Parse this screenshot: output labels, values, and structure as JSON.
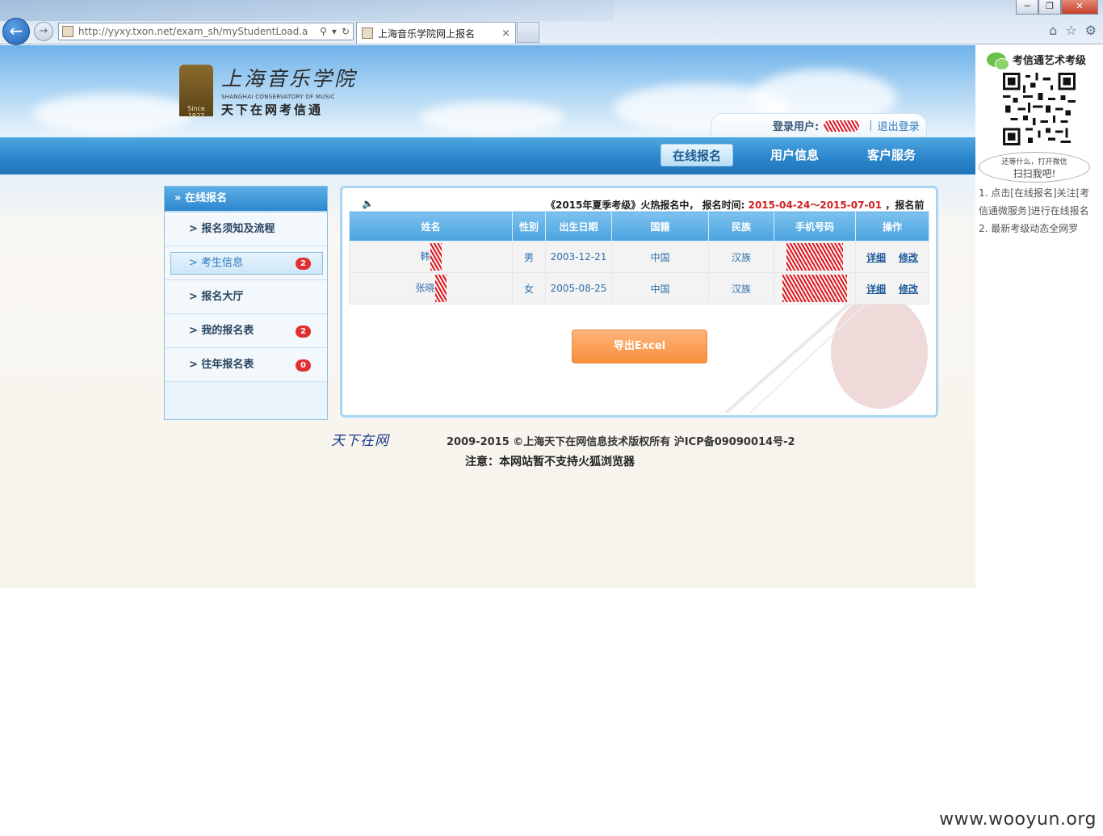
{
  "browser": {
    "url": "http://yyxy.txon.net/exam_sh/myStudentLoad.actic",
    "tab_title": "上海音乐学院网上报名",
    "tab_close": "×",
    "win_minimize": "─",
    "win_maximize": "❐",
    "win_close": "✕"
  },
  "header": {
    "school_cn": "上海音乐学院",
    "school_en": "SHANGHAI CONSERVATORY OF MUSIC",
    "since": "Since 1927",
    "slogan": "天下在网考信通",
    "login_label": "登录用户:",
    "username": "",
    "logout": "退出登录"
  },
  "nav": {
    "items": [
      {
        "label": "在线报名",
        "active": true
      },
      {
        "label": "用户信息",
        "active": false
      },
      {
        "label": "客户服务",
        "active": false
      }
    ]
  },
  "sidebar": {
    "title": "在线报名",
    "items": [
      {
        "label": "> 报名须知及流程",
        "badge": ""
      },
      {
        "label": "> 考生信息",
        "badge": "2"
      },
      {
        "label": "> 报名大厅",
        "badge": ""
      },
      {
        "label": "> 我的报名表",
        "badge": "2"
      },
      {
        "label": "> 往年报名表",
        "badge": "0"
      }
    ]
  },
  "announcement": {
    "prefix": "《2015年夏季考级》火热报名中，",
    "time_label": "报名时间:",
    "dates": "2015-04-24～2015-07-01",
    "suffix": "，报名前"
  },
  "table": {
    "headers": [
      "姓名",
      "性别",
      "出生日期",
      "国籍",
      "民族",
      "手机号码",
      "操作"
    ],
    "rows": [
      {
        "name": "韩",
        "gender": "男",
        "birth": "2003-12-21",
        "nationality": "中国",
        "ethnicity": "汉族",
        "phone": "",
        "detail": "详细",
        "edit": "修改"
      },
      {
        "name": "张晓",
        "gender": "女",
        "birth": "2005-08-25",
        "nationality": "中国",
        "ethnicity": "汉族",
        "phone": "",
        "detail": "详细",
        "edit": "修改"
      }
    ]
  },
  "export_button": "导出Excel",
  "footer": {
    "logo_text": "天下在网",
    "copyright": "2009-2015 ©上海天下在网信息技术版权所有 沪ICP备09090014号-2",
    "notice": "注意：本网站暂不支持火狐浏览器"
  },
  "ad": {
    "title": "考信通艺术考级",
    "bubble_line1": "还等什么，打开微信",
    "bubble_line2": "扫扫我吧!",
    "line1": "1. 点击[在线报名]关注[考",
    "line2": "信通微服务]进行在线报名",
    "line3": "2. 最新考级动态全网罗"
  },
  "watermark": "www.wooyun.org"
}
